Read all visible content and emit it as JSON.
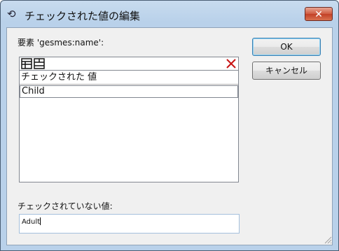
{
  "window": {
    "title": "チェックされた値の編集",
    "close_label": "✕"
  },
  "element_label": "要素 'gesmes:name':",
  "list": {
    "header": "チェックされた 値",
    "rows": [
      "Child"
    ]
  },
  "unchecked_label": "チェックされていない値:",
  "unchecked_value": "Adult",
  "buttons": {
    "ok": "OK",
    "cancel": "キャンセル"
  }
}
